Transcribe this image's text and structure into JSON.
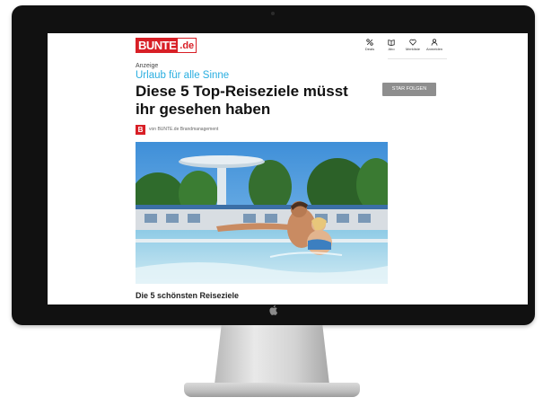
{
  "site": {
    "logo_main": "BUNTE",
    "logo_suffix": ".de"
  },
  "nav": [
    {
      "label": "Deals",
      "icon": "percent-icon"
    },
    {
      "label": "Abo",
      "icon": "magazine-icon"
    },
    {
      "label": "Merkliste",
      "icon": "heart-icon"
    },
    {
      "label": "Anmelden",
      "icon": "user-icon"
    }
  ],
  "article": {
    "ad_label": "Anzeige",
    "kicker": "Urlaub für alle Sinne",
    "headline": "Diese 5 Top-Reiseziele müsst ihr gesehen haben",
    "follow_button": "STAR FOLGEN",
    "author_badge": "B",
    "author_text": "von BUNTE.de Brandmanagement",
    "image_alt": "Paar im Thermalbecken",
    "section_heading": "Die 5 schönsten Reiseziele"
  },
  "colors": {
    "brand_red": "#d81f26",
    "kicker_blue": "#29aee0",
    "button_gray": "#8e8e8e",
    "bezel": "#111111"
  }
}
